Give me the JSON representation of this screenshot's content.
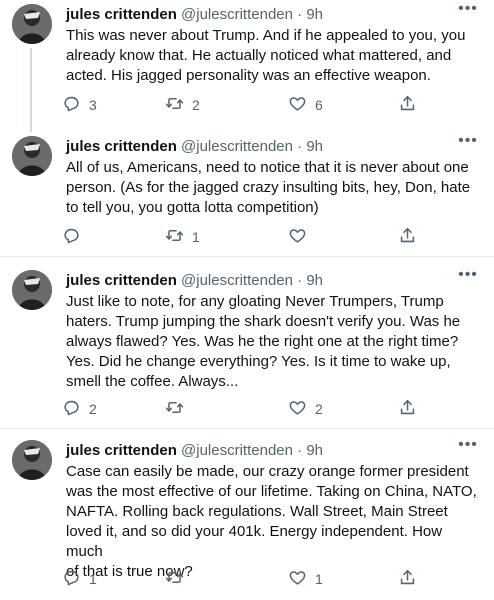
{
  "author": {
    "name": "jules crittenden",
    "handle": "@julescrittenden",
    "separator": "·"
  },
  "tweets": [
    {
      "time": "9h",
      "text_lines": [
        "This was never about Trump. And if he appealed to you, you",
        "already know that. He actually noticed what mattered, and",
        "acted. His jagged personality was an effective weapon."
      ],
      "replies": "3",
      "retweets": "2",
      "likes": "6"
    },
    {
      "time": "9h",
      "text_lines": [
        "All of us, Americans, need to notice that it is never about one",
        "person. (As for the jagged crazy insulting bits, hey, Don, hate",
        "to tell you, you gotta lotta competition)"
      ],
      "replies": "",
      "retweets": "1",
      "likes": ""
    },
    {
      "time": "9h",
      "text_lines": [
        "Just like to note, for any gloating Never Trumpers, Trump",
        "haters. Trump jumping the shark doesn't verify you. Was he",
        "always flawed? Yes. Was he the right one at the right time?",
        "Yes. Did he change everything? Yes. Is it time to wake up,",
        "smell the coffee. Always..."
      ],
      "replies": "2",
      "retweets": "",
      "likes": "2"
    },
    {
      "time": "9h",
      "text_lines": [
        "Case can easily be made, our crazy orange former president",
        "was the most effective of our lifetime. Taking on China, NATO,",
        "NAFTA. Rolling back regulations. Wall Street, Main Street",
        "loved it, and so did your 401k. Energy independent. How much",
        "of that is true now?"
      ],
      "replies": "1",
      "retweets": "",
      "likes": "1"
    }
  ],
  "icons": {
    "reply": "reply-icon",
    "retweet": "retweet-icon",
    "like": "heart-icon",
    "share": "share-icon",
    "more": "more-icon"
  },
  "colors": {
    "text": "#0f1419",
    "secondary": "#536471",
    "divider": "#e6ecf0",
    "thread": "#cfd9de"
  }
}
